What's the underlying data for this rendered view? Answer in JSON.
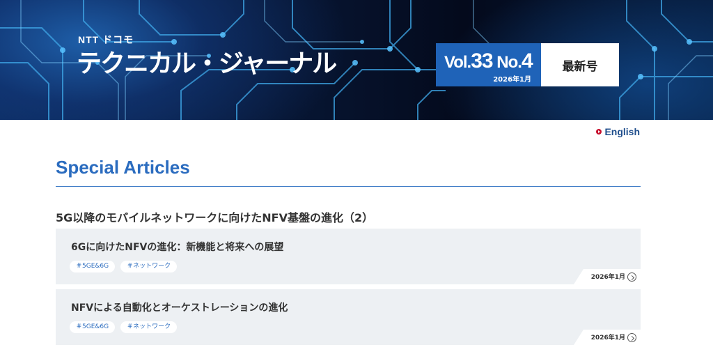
{
  "header": {
    "brand": "NTT ドコモ",
    "title": "テクニカル・ジャーナル",
    "issue": {
      "vol_prefix": "Vol.",
      "vol_number": "33",
      "no_prefix": "No.",
      "no_number": "4",
      "date": "2026年1月"
    },
    "latest_label": "最新号"
  },
  "language_link": "English",
  "section": {
    "title": "Special Articles",
    "topic": "5G以降のモバイルネットワークに向けたNFV基盤の進化（2）"
  },
  "articles": [
    {
      "title": "6Gに向けたNFVの進化：新機能と将来への展望",
      "tags": [
        "＃5GE&6G",
        "＃ネットワーク"
      ],
      "date": "2026年1月"
    },
    {
      "title": "NFVによる自動化とオーケストレーションの進化",
      "tags": [
        "＃5GE&6G",
        "＃ネットワーク"
      ],
      "date": "2026年1月"
    }
  ],
  "colors": {
    "accent_blue": "#2b6cbf",
    "issue_blue": "#1f63b8",
    "link_red": "#c8102e",
    "card_bg": "#edf0f3"
  },
  "icons": [
    "circle-arrow-right-icon",
    "chevron-right-circle-icon"
  ]
}
